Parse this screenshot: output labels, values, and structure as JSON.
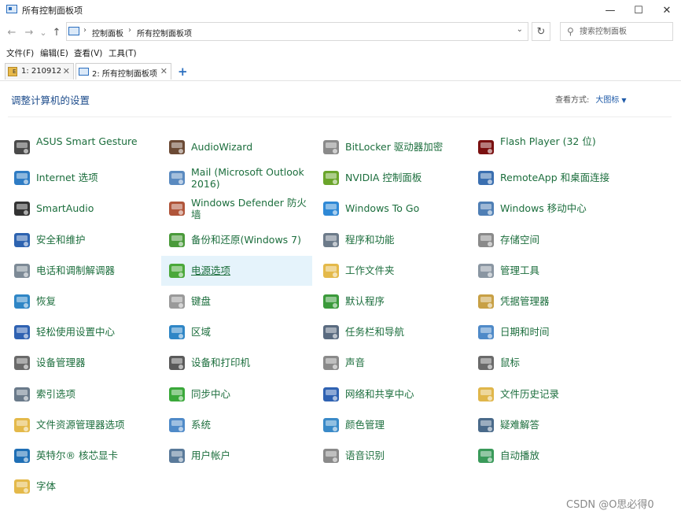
{
  "window": {
    "title": "所有控制面板项",
    "min_glyph": "—",
    "max_glyph": "☐",
    "close_glyph": "✕"
  },
  "nav": {
    "back_glyph": "←",
    "forward_glyph": "→",
    "history_glyph": "⌄",
    "up_glyph": "↑",
    "refresh_glyph": "↻",
    "breadcrumb": [
      "控制面板",
      "所有控制面板项"
    ],
    "sep_glyph": "›",
    "drop_glyph": "⌄",
    "search_placeholder": "搜索控制面板",
    "search_glyph": "⚲"
  },
  "menu": [
    "文件(F)",
    "编辑(E)",
    "查看(V)",
    "工具(T)"
  ],
  "tabs": [
    {
      "label": "1:  210912",
      "close": "✕",
      "active": false
    },
    {
      "label": "2:  所有控制面板项",
      "close": "✕",
      "active": true
    }
  ],
  "new_tab_glyph": "+",
  "heading": "调整计算机的设置",
  "view_by": {
    "label": "查看方式:",
    "selected": "大图标",
    "caret": "▼"
  },
  "items": [
    {
      "label": "ASUS Smart Gesture",
      "icon": "touchpad-gesture-icon",
      "color": "#4a4a4a",
      "col": 0,
      "row": 0
    },
    {
      "label": "AudioWizard",
      "icon": "audio-wizard-icon",
      "color": "#6b4a35",
      "col": 1,
      "row": 0
    },
    {
      "label": "BitLocker 驱动器加密",
      "icon": "bitlocker-key-icon",
      "color": "#8a8a8a",
      "col": 2,
      "row": 0
    },
    {
      "label": "Flash Player (32 位)",
      "icon": "flash-player-icon",
      "color": "#7a1010",
      "col": 3,
      "row": 0
    },
    {
      "label": "Internet 选项",
      "icon": "internet-globe-icon",
      "color": "#2f7cc4",
      "col": 0,
      "row": 1
    },
    {
      "label": "Mail (Microsoft Outlook 2016)",
      "icon": "mail-icon",
      "color": "#5a8ac0",
      "col": 1,
      "row": 1
    },
    {
      "label": "NVIDIA 控制面板",
      "icon": "nvidia-icon",
      "color": "#6ba52b",
      "col": 2,
      "row": 1
    },
    {
      "label": "RemoteApp 和桌面连接",
      "icon": "remote-desktop-icon",
      "color": "#3a6fb0",
      "col": 3,
      "row": 1
    },
    {
      "label": "SmartAudio",
      "icon": "headphones-icon",
      "color": "#333333",
      "col": 0,
      "row": 2
    },
    {
      "label": "Windows Defender 防火墙",
      "icon": "firewall-icon",
      "color": "#b0553a",
      "col": 1,
      "row": 2
    },
    {
      "label": "Windows To Go",
      "icon": "windows-to-go-icon",
      "color": "#2f89d6",
      "col": 2,
      "row": 2
    },
    {
      "label": "Windows 移动中心",
      "icon": "mobility-center-icon",
      "color": "#4f7fb5",
      "col": 3,
      "row": 2
    },
    {
      "label": "安全和维护",
      "icon": "security-flag-icon",
      "color": "#2d63b0",
      "col": 0,
      "row": 3
    },
    {
      "label": "备份和还原(Windows 7)",
      "icon": "backup-restore-icon",
      "color": "#4a9a3a",
      "col": 1,
      "row": 3
    },
    {
      "label": "程序和功能",
      "icon": "programs-features-icon",
      "color": "#6d7b8a",
      "col": 2,
      "row": 3
    },
    {
      "label": "存储空间",
      "icon": "storage-spaces-icon",
      "color": "#8a8a8a",
      "col": 3,
      "row": 3
    },
    {
      "label": "电话和调制解调器",
      "icon": "phone-modem-icon",
      "color": "#7d8a96",
      "col": 0,
      "row": 4
    },
    {
      "label": "电源选项",
      "icon": "power-options-icon",
      "color": "#4aa83a",
      "col": 1,
      "row": 4,
      "highlighted": true
    },
    {
      "label": "工作文件夹",
      "icon": "work-folders-icon",
      "color": "#e4b94a",
      "col": 2,
      "row": 4
    },
    {
      "label": "管理工具",
      "icon": "admin-tools-icon",
      "color": "#8a96a2",
      "col": 3,
      "row": 4
    },
    {
      "label": "恢复",
      "icon": "recovery-icon",
      "color": "#2f86c6",
      "col": 0,
      "row": 5
    },
    {
      "label": "键盘",
      "icon": "keyboard-icon",
      "color": "#9a9a9a",
      "col": 1,
      "row": 5
    },
    {
      "label": "默认程序",
      "icon": "default-programs-icon",
      "color": "#3b9a3b",
      "col": 2,
      "row": 5
    },
    {
      "label": "凭据管理器",
      "icon": "credential-manager-icon",
      "color": "#c8a045",
      "col": 3,
      "row": 5
    },
    {
      "label": "轻松使用设置中心",
      "icon": "ease-of-access-icon",
      "color": "#2f62b2",
      "col": 0,
      "row": 6
    },
    {
      "label": "区域",
      "icon": "region-globe-icon",
      "color": "#2f86c6",
      "col": 1,
      "row": 6
    },
    {
      "label": "任务栏和导航",
      "icon": "taskbar-icon",
      "color": "#5a6b80",
      "col": 2,
      "row": 6
    },
    {
      "label": "日期和时间",
      "icon": "date-time-icon",
      "color": "#4f8ac8",
      "col": 3,
      "row": 6
    },
    {
      "label": "设备管理器",
      "icon": "device-manager-icon",
      "color": "#6a6a6a",
      "col": 0,
      "row": 7
    },
    {
      "label": "设备和打印机",
      "icon": "devices-printers-icon",
      "color": "#5a5a5a",
      "col": 1,
      "row": 7
    },
    {
      "label": "声音",
      "icon": "sound-icon",
      "color": "#8a8a8a",
      "col": 2,
      "row": 7
    },
    {
      "label": "鼠标",
      "icon": "mouse-icon",
      "color": "#6a6a6a",
      "col": 3,
      "row": 7
    },
    {
      "label": "索引选项",
      "icon": "indexing-icon",
      "color": "#6a7a8a",
      "col": 0,
      "row": 8
    },
    {
      "label": "同步中心",
      "icon": "sync-center-icon",
      "color": "#3aa83a",
      "col": 1,
      "row": 8
    },
    {
      "label": "网络和共享中心",
      "icon": "network-sharing-icon",
      "color": "#2f62b2",
      "col": 2,
      "row": 8
    },
    {
      "label": "文件历史记录",
      "icon": "file-history-icon",
      "color": "#e0b64a",
      "col": 3,
      "row": 8
    },
    {
      "label": "文件资源管理器选项",
      "icon": "explorer-options-icon",
      "color": "#e4b94a",
      "col": 0,
      "row": 9
    },
    {
      "label": "系统",
      "icon": "system-icon",
      "color": "#4f8ac8",
      "col": 1,
      "row": 9
    },
    {
      "label": "颜色管理",
      "icon": "color-management-icon",
      "color": "#3a8ac8",
      "col": 2,
      "row": 9
    },
    {
      "label": "疑难解答",
      "icon": "troubleshooting-icon",
      "color": "#4a6a8a",
      "col": 3,
      "row": 9
    },
    {
      "label": "英特尔® 核芯显卡",
      "icon": "intel-graphics-icon",
      "color": "#1f6fb5",
      "col": 0,
      "row": 10
    },
    {
      "label": "用户帐户",
      "icon": "user-accounts-icon",
      "color": "#5a7a9a",
      "col": 1,
      "row": 10
    },
    {
      "label": "语音识别",
      "icon": "microphone-icon",
      "color": "#8a8a8a",
      "col": 2,
      "row": 10
    },
    {
      "label": "自动播放",
      "icon": "autoplay-icon",
      "color": "#3a9a5a",
      "col": 3,
      "row": 10
    },
    {
      "label": "字体",
      "icon": "fonts-icon",
      "color": "#e4b94a",
      "col": 0,
      "row": 11
    }
  ],
  "watermark": "CSDN @O思必得0"
}
